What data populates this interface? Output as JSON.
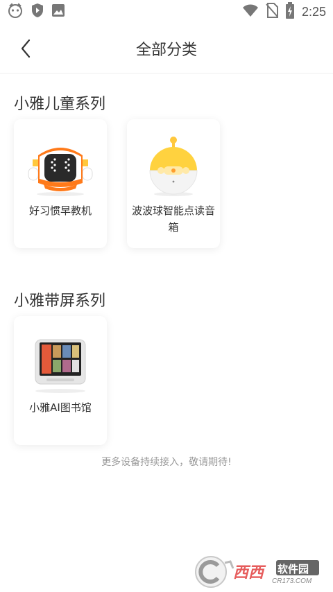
{
  "status_bar": {
    "time": "2:25",
    "left_icons": [
      "app-mascot-icon",
      "play-shield-icon",
      "image-icon"
    ],
    "right_icons": [
      "wifi-icon",
      "no-sim-icon",
      "battery-charging-icon"
    ]
  },
  "header": {
    "title": "全部分类",
    "back_icon": "chevron-left-icon"
  },
  "sections": [
    {
      "title": "小雅儿童系列",
      "items": [
        {
          "label": "好习惯早教机",
          "icon": "robot-device-icon"
        },
        {
          "label": "波波球智能点读音箱",
          "icon": "yellow-ball-speaker-icon"
        }
      ]
    },
    {
      "title": "小雅带屏系列",
      "items": [
        {
          "label": "小雅AI图书馆",
          "icon": "screen-device-icon"
        }
      ]
    }
  ],
  "footer_note": "更多设备持续接入，敬请期待!",
  "watermark": {
    "brand": "西西",
    "subtitle": "软件园",
    "domain": "CR173.COM"
  },
  "colors": {
    "accent_orange": "#FF7A1A",
    "accent_yellow": "#FFC83D",
    "text": "#333333",
    "muted": "#999999"
  }
}
